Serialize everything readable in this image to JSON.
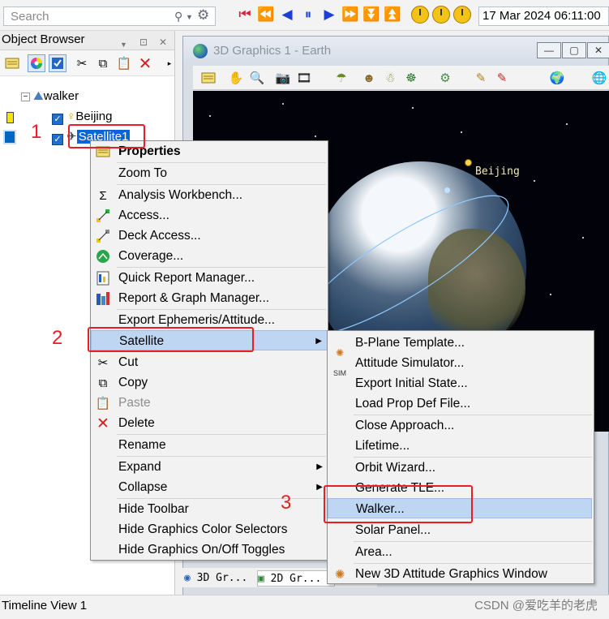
{
  "search": {
    "placeholder": "Search"
  },
  "timestamp": "17 Mar 2024 06:11:00",
  "object_browser": {
    "title": "Object Browser",
    "tree": {
      "root": "walker",
      "children": [
        {
          "label": "Beijing",
          "swatch_color": "#f4e400"
        },
        {
          "label": "Satellite1",
          "swatch_color": "#0067c0"
        }
      ]
    }
  },
  "window3d": {
    "title": "3D Graphics 1 - Earth",
    "scene_label": "Beijing",
    "tabs": [
      "3D Gr...",
      "2D Gr..."
    ]
  },
  "context_menu": {
    "items": [
      {
        "label": "Properties",
        "icon": "properties-icon",
        "bold": true
      },
      {
        "label": "Zoom To",
        "icon": ""
      },
      {
        "label": "Analysis Workbench...",
        "icon": "workbench-icon"
      },
      {
        "label": "Access...",
        "icon": "access-icon"
      },
      {
        "label": "Deck Access...",
        "icon": "deck-access-icon"
      },
      {
        "label": "Coverage...",
        "icon": "coverage-icon"
      },
      {
        "label": "Quick Report Manager...",
        "icon": "report-icon"
      },
      {
        "label": "Report & Graph Manager...",
        "icon": "graph-icon"
      },
      {
        "label": "Export Ephemeris/Attitude...",
        "icon": ""
      },
      {
        "label": "Satellite",
        "icon": "",
        "submenu": true,
        "selected": true
      },
      {
        "label": "Cut",
        "icon": "cut-icon"
      },
      {
        "label": "Copy",
        "icon": "copy-icon"
      },
      {
        "label": "Paste",
        "icon": "paste-icon",
        "disabled": true
      },
      {
        "label": "Delete",
        "icon": "delete-icon"
      },
      {
        "label": "Rename",
        "icon": ""
      },
      {
        "label": "Expand",
        "icon": "",
        "submenu": true
      },
      {
        "label": "Collapse",
        "icon": "",
        "submenu": true
      },
      {
        "label": "Hide Toolbar",
        "icon": ""
      },
      {
        "label": "Hide Graphics Color Selectors",
        "icon": ""
      },
      {
        "label": "Hide Graphics On/Off Toggles",
        "icon": ""
      }
    ]
  },
  "submenu": {
    "items": [
      {
        "label": "B-Plane Template...",
        "icon": ""
      },
      {
        "label": "Attitude Simulator...",
        "icon": "sim-icon"
      },
      {
        "label": "Export Initial State...",
        "icon": ""
      },
      {
        "label": "Load Prop Def File...",
        "icon": ""
      },
      {
        "label": "Close Approach...",
        "icon": ""
      },
      {
        "label": "Lifetime...",
        "icon": ""
      },
      {
        "label": "Orbit Wizard...",
        "icon": ""
      },
      {
        "label": "Generate TLE...",
        "icon": ""
      },
      {
        "label": "Walker...",
        "icon": "",
        "selected": true
      },
      {
        "label": "Solar Panel...",
        "icon": ""
      },
      {
        "label": "Area...",
        "icon": ""
      },
      {
        "label": "New 3D Attitude Graphics Window",
        "icon": "attitude-window-icon"
      }
    ]
  },
  "annotations": [
    "1",
    "2",
    "3"
  ],
  "status_bar": {
    "left": "Timeline View 1"
  },
  "watermark": "CSDN @爱吃羊的老虎"
}
